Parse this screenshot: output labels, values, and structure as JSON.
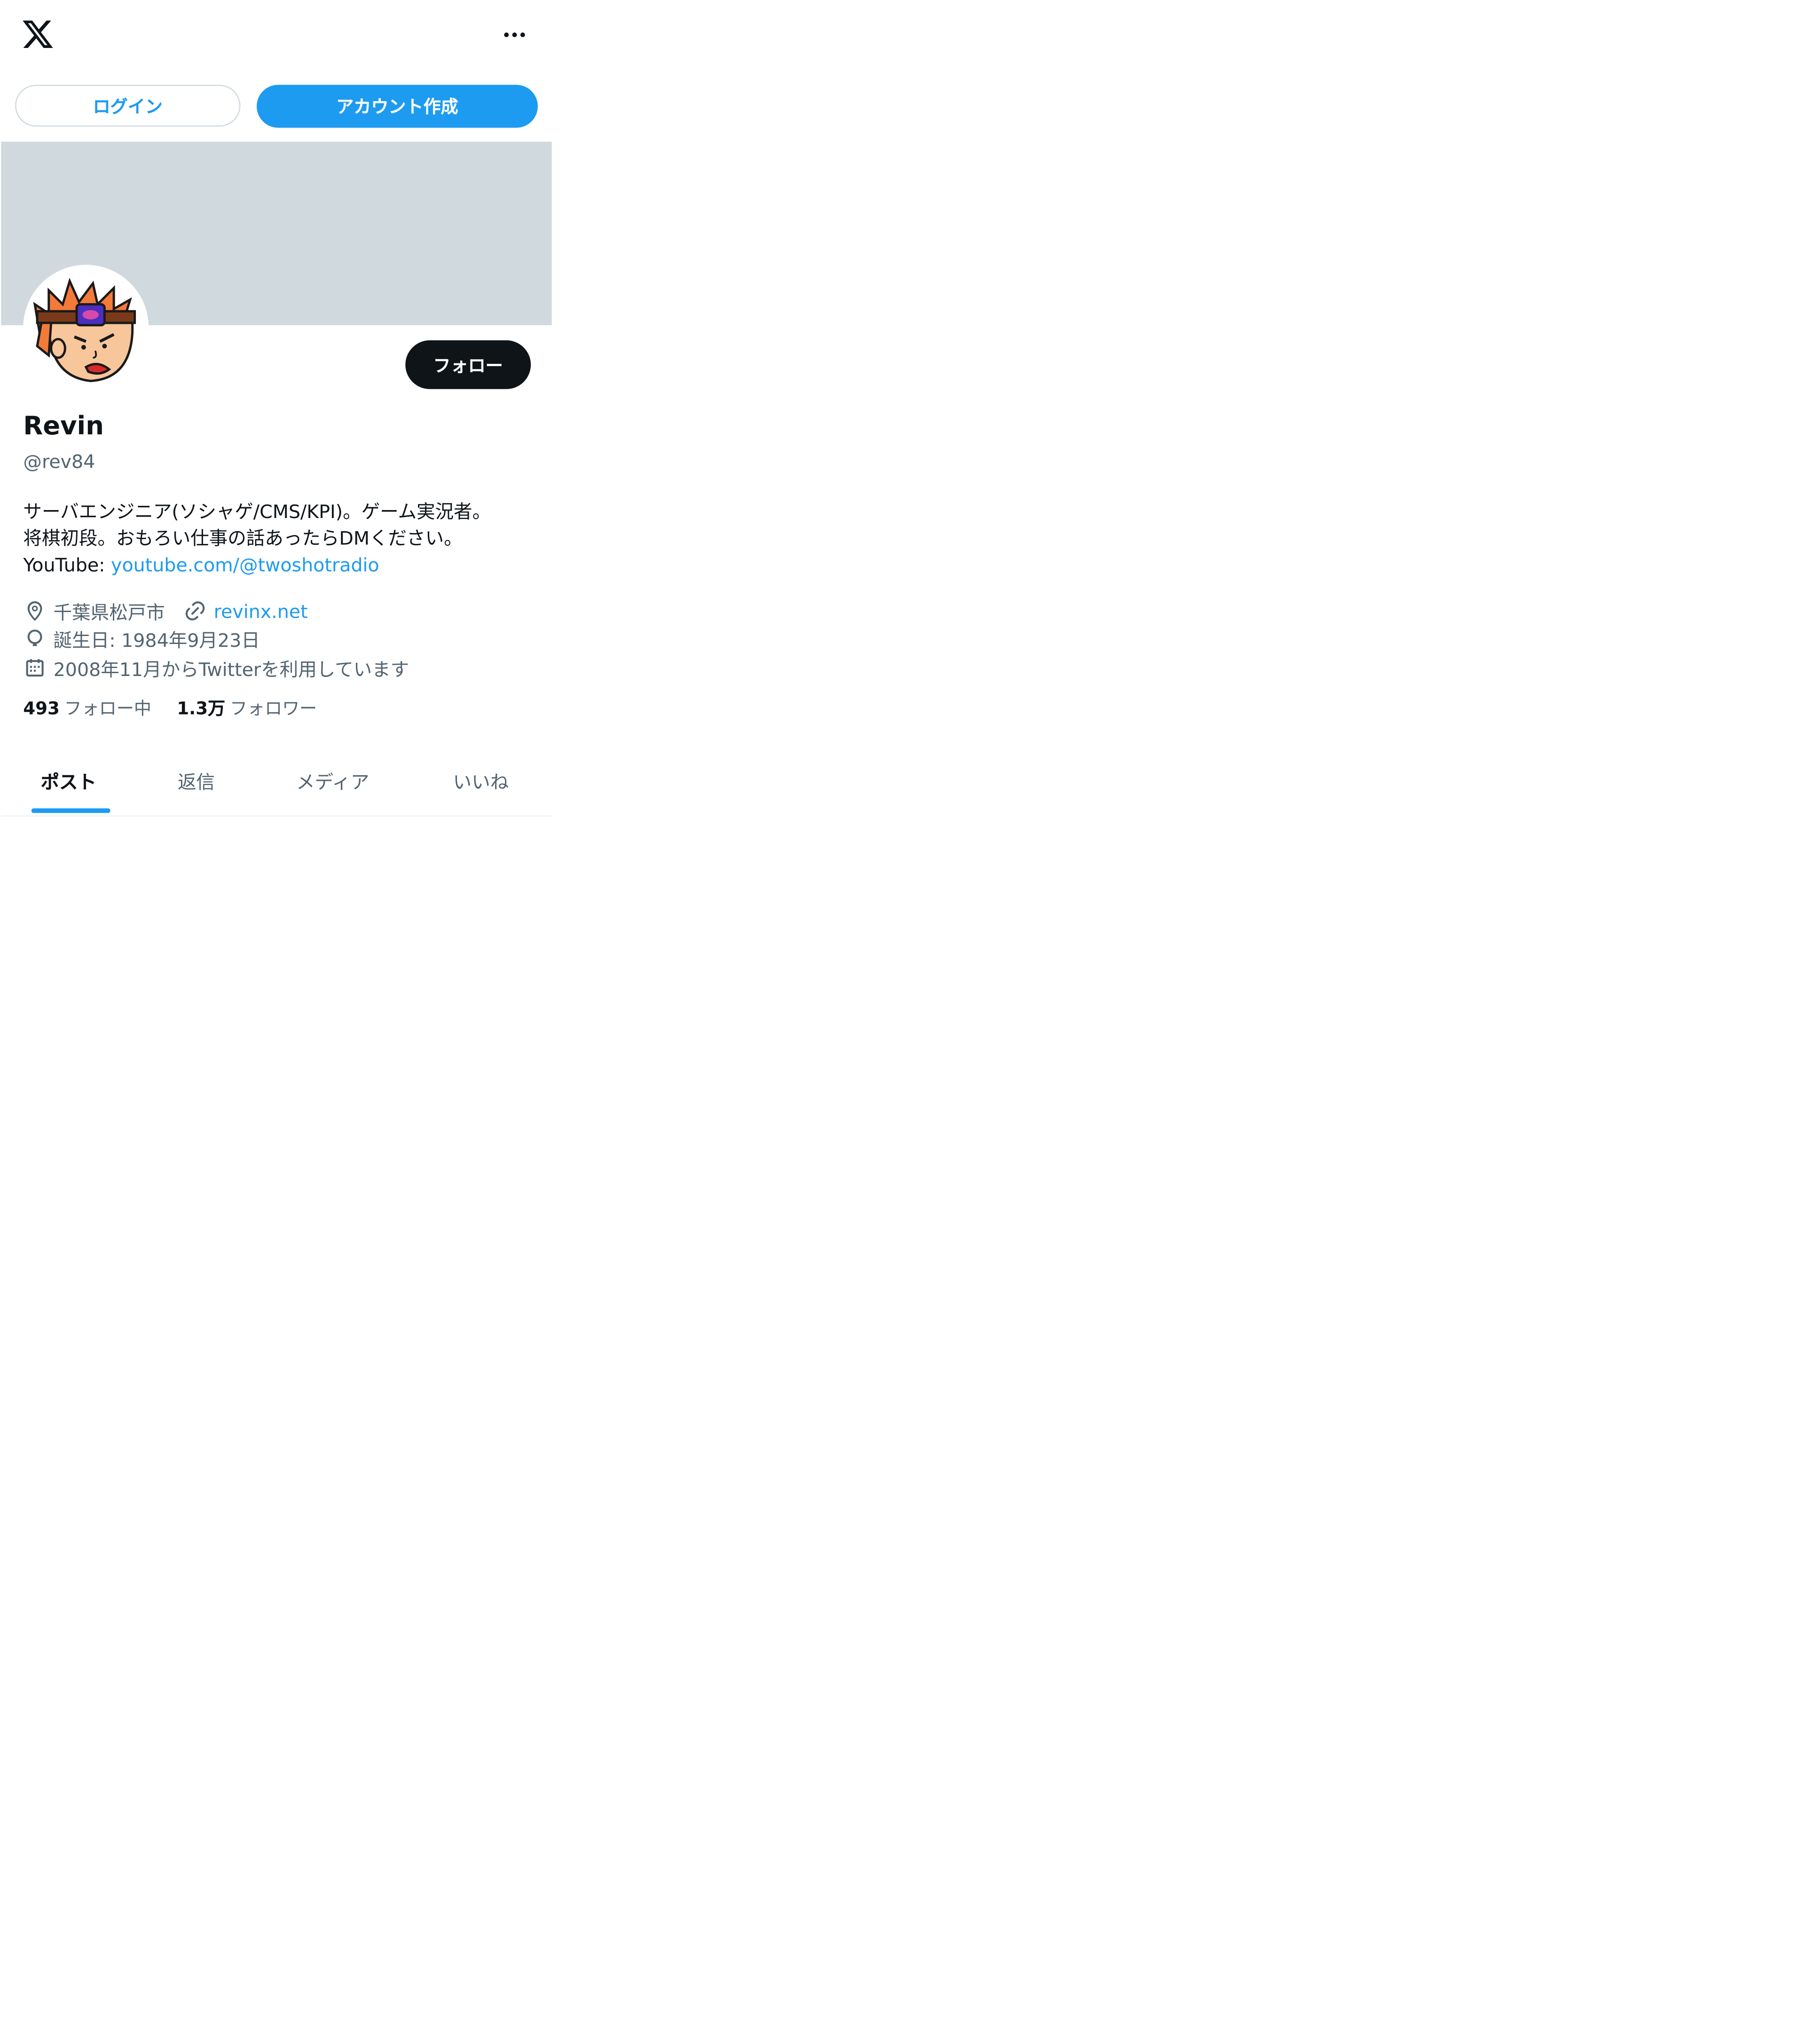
{
  "header": {
    "logo_icon": "x-logo-icon",
    "more_icon": "more-horizontal-icon"
  },
  "auth": {
    "login_label": "ログイン",
    "signup_label": "アカウント作成"
  },
  "profile": {
    "name": "Revin",
    "handle": "@rev84",
    "follow_label": "フォロー",
    "bio_line1": "サーバエンジニア(ソシャゲ/CMS/KPI)。ゲーム実況者。",
    "bio_line2": "将棋初段。おもろい仕事の話あったらDMください。",
    "bio_line3_prefix": "YouTube: ",
    "bio_line3_link": "youtube.com/@twoshotradio",
    "location": "千葉県松戸市",
    "website": "revinx.net",
    "birthday": "誕生日: 1984年9月23日",
    "joined": "2008年11月からTwitterを利用しています",
    "following_count": "493",
    "following_label": "フォロー中",
    "followers_count": "1.3万",
    "followers_label": "フォロワー"
  },
  "tabs": [
    {
      "label": "ポスト",
      "active": true
    },
    {
      "label": "返信",
      "active": false
    },
    {
      "label": "メディア",
      "active": false
    },
    {
      "label": "いいね",
      "active": false
    }
  ],
  "colors": {
    "accent": "#1d9bf0",
    "text": "#0f1419",
    "muted": "#536471",
    "banner": "#cfd9de"
  }
}
